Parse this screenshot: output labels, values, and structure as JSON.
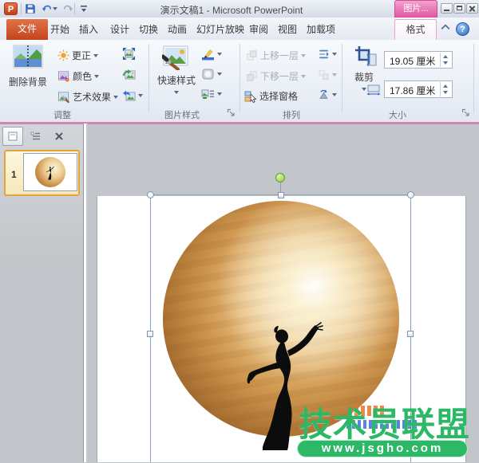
{
  "titlebar": {
    "title": "演示文稿1 - Microsoft PowerPoint",
    "logo_letter": "P",
    "contextual_group_label": "图片...",
    "help_glyph": "?"
  },
  "tabs": {
    "items": [
      {
        "label": "文件"
      },
      {
        "label": "开始"
      },
      {
        "label": "插入"
      },
      {
        "label": "设计"
      },
      {
        "label": "切换"
      },
      {
        "label": "动画"
      },
      {
        "label": "幻灯片放映"
      },
      {
        "label": "审阅"
      },
      {
        "label": "视图"
      },
      {
        "label": "加载项"
      },
      {
        "label": "格式"
      }
    ],
    "active": "格式"
  },
  "ribbon": {
    "adjust": {
      "group_label": "调整",
      "remove_background": "删除背景",
      "corrections": "更正",
      "color": "颜色",
      "artistic_effects": "艺术效果"
    },
    "picture_styles": {
      "group_label": "图片样式",
      "quick_styles": "快速样式"
    },
    "arrange": {
      "group_label": "排列",
      "bring_forward": "上移一层",
      "send_backward": "下移一层",
      "selection_pane": "选择窗格"
    },
    "size": {
      "group_label": "大小",
      "crop": "裁剪",
      "height_value": "19.05 厘米",
      "width_value": "17.86 厘米"
    }
  },
  "slides_panel": {
    "slide_number": "1"
  },
  "watermark": {
    "title": "技术员联盟",
    "url": "www.jsgho.com"
  },
  "colors": {
    "contextual_pink": "#e1549f",
    "file_tab_orange": "#c5431c",
    "watermark_green": "#2db867",
    "selection_blue": "#8ba1bb",
    "rotation_green": "#8cc63f",
    "moon_gold": "#d09a52"
  }
}
